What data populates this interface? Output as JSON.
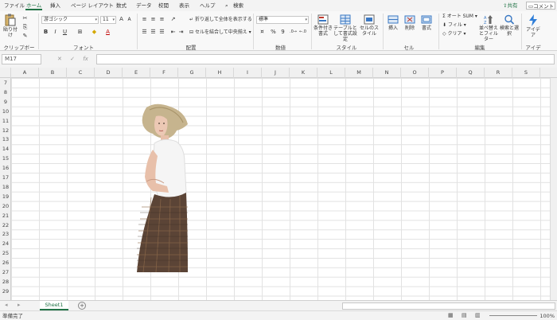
{
  "menu": {
    "tabs": [
      "ファイル",
      "ホーム",
      "挿入",
      "ページ レイアウト",
      "数式",
      "データ",
      "校閲",
      "表示",
      "ヘルプ",
      "検索"
    ],
    "share_label": "共有",
    "comment_label": "コメント"
  },
  "ribbon": {
    "clipboard": {
      "paste": "貼り付け",
      "group": "クリップボード"
    },
    "font": {
      "name": "游ゴシック",
      "size": "11",
      "bold": "B",
      "italic": "I",
      "underline": "U",
      "group": "フォント"
    },
    "alignment": {
      "wrap": "折り返して全体を表示する",
      "merge": "セルを結合して中央揃え",
      "group": "配置"
    },
    "number": {
      "format": "標準",
      "percent": "%",
      "comma": "9",
      "group": "数値"
    },
    "styles": {
      "conditional": "条件付き書式",
      "table": "テーブルとして書式設定",
      "cell": "セルのスタイル",
      "group": "スタイル"
    },
    "cells": {
      "insert": "挿入",
      "delete": "削除",
      "format": "書式",
      "group": "セル"
    },
    "editing": {
      "autosum": "オート SUM",
      "fill": "フィル",
      "clear": "クリア",
      "sort": "並べ替えとフィルター",
      "find": "検索と選択",
      "group": "編集"
    },
    "ideas": {
      "label": "アイデア",
      "group": "アイデア"
    }
  },
  "formula_bar": {
    "name_box": "M17",
    "fx": "fx",
    "value": ""
  },
  "columns": [
    "A",
    "B",
    "C",
    "D",
    "E",
    "F",
    "G",
    "H",
    "I",
    "J",
    "K",
    "L",
    "M",
    "N",
    "O",
    "P",
    "Q",
    "R",
    "S"
  ],
  "rows": [
    "7",
    "8",
    "9",
    "10",
    "11",
    "12",
    "13",
    "14",
    "15",
    "16",
    "17",
    "18",
    "19",
    "20",
    "21",
    "22",
    "23",
    "24",
    "25",
    "26",
    "27",
    "28",
    "29"
  ],
  "sheet": {
    "tab": "Sheet1"
  },
  "status": {
    "text": "準備完了",
    "zoom": "100%"
  },
  "colors": {
    "accent": "#217346"
  }
}
